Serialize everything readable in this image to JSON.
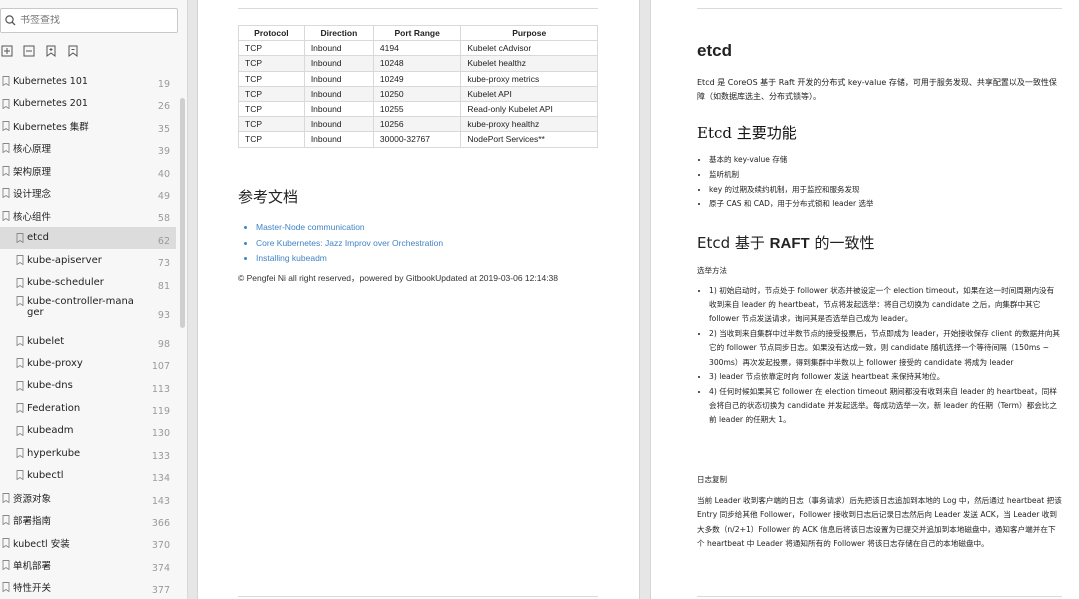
{
  "sidebar": {
    "search_placeholder": "书签查找",
    "items": [
      {
        "label": "Kubernetes 101",
        "page": "19",
        "level": 0
      },
      {
        "label": "Kubernetes 201",
        "page": "26",
        "level": 0
      },
      {
        "label": "Kubernetes 集群",
        "page": "35",
        "level": 0
      },
      {
        "label": "核心原理",
        "page": "39",
        "level": 0
      },
      {
        "label": "架构原理",
        "page": "40",
        "level": 0
      },
      {
        "label": "设计理念",
        "page": "49",
        "level": 0
      },
      {
        "label": "核心组件",
        "page": "58",
        "level": 0
      },
      {
        "label": "etcd",
        "page": "62",
        "level": 1,
        "active": true
      },
      {
        "label": "kube-apiserver",
        "page": "73",
        "level": 1
      },
      {
        "label": "kube-scheduler",
        "page": "81",
        "level": 1
      },
      {
        "label": "kube-controller-mana\nger",
        "page": "93",
        "level": 1
      },
      {
        "label": "kubelet",
        "page": "98",
        "level": 1
      },
      {
        "label": "kube-proxy",
        "page": "107",
        "level": 1
      },
      {
        "label": "kube-dns",
        "page": "113",
        "level": 1
      },
      {
        "label": "Federation",
        "page": "119",
        "level": 1
      },
      {
        "label": "kubeadm",
        "page": "130",
        "level": 1
      },
      {
        "label": "hyperkube",
        "page": "133",
        "level": 1
      },
      {
        "label": "kubectl",
        "page": "134",
        "level": 1
      },
      {
        "label": "资源对象",
        "page": "143",
        "level": 0
      },
      {
        "label": "部署指南",
        "page": "366",
        "level": 0
      },
      {
        "label": "kubectl 安装",
        "page": "370",
        "level": 0
      },
      {
        "label": "单机部署",
        "page": "374",
        "level": 0
      },
      {
        "label": "特性开关",
        "page": "377",
        "level": 0
      }
    ]
  },
  "left_page": {
    "table": {
      "headers": [
        "Protocol",
        "Direction",
        "Port Range",
        "Purpose"
      ],
      "rows": [
        [
          "TCP",
          "Inbound",
          "4194",
          "Kubelet cAdvisor"
        ],
        [
          "TCP",
          "Inbound",
          "10248",
          "Kubelet healthz"
        ],
        [
          "TCP",
          "Inbound",
          "10249",
          "kube-proxy metrics"
        ],
        [
          "TCP",
          "Inbound",
          "10250",
          "Kubelet API"
        ],
        [
          "TCP",
          "Inbound",
          "10255",
          "Read-only Kubelet API"
        ],
        [
          "TCP",
          "Inbound",
          "10256",
          "kube-proxy healthz"
        ],
        [
          "TCP",
          "Inbound",
          "30000-32767",
          "NodePort Services**"
        ]
      ]
    },
    "ref_title": "参考文档",
    "links": [
      "Master-Node communication",
      "Core Kubernetes: Jazz Improv over Orchestration",
      "Installing kubeadm"
    ],
    "copyright": "© Pengfei Ni all right reserved，powered by GitbookUpdated at 2019-03-06 12:14:38"
  },
  "right_page": {
    "title": "etcd",
    "intro": "Etcd 是 CoreOS 基于 Raft 开发的分布式 key-value 存储，可用于服务发现、共享配置以及一致性保障（如数据库选主、分布式锁等）。",
    "func_title": "Etcd 主要功能",
    "features": [
      "基本的 key-value 存储",
      "监听机制",
      "key 的过期及续约机制，用于监控和服务发现",
      "原子 CAS 和 CAD，用于分布式锁和 leader 选举"
    ],
    "raft_title_prefix": "Etcd 基于 ",
    "raft_title_bold": "RAFT",
    "raft_title_suffix": " 的一致性",
    "election_heading": "选举方法",
    "steps": [
      "1) 初始启动时，节点处于 follower 状态并被设定一个 election timeout，如果在这一时间周期内没有收到来自 leader 的 heartbeat，节点将发起选举：将自己切换为 candidate 之后，向集群中其它 follower 节点发送请求，询问其是否选举自己成为 leader。",
      "2) 当收到来自集群中过半数节点的接受投票后，节点即成为 leader，开始接收保存 client 的数据并向其它的 follower 节点同步日志。如果没有达成一致，则 candidate 随机选择一个等待间隔（150ms ~ 300ms）再次发起投票，得到集群中半数以上 follower 接受的 candidate 将成为 leader",
      "3) leader 节点依靠定时向 follower 发送 heartbeat 来保持其地位。",
      "4) 任何时候如果其它 follower 在 election timeout 期间都没有收到来自 leader 的 heartbeat，同样会将自己的状态切换为 candidate 并发起选举。每成功选举一次，新 leader 的任期（Term）都会比之前 leader 的任期大 1。"
    ],
    "log_heading": "日志复制",
    "log_para": "当前 Leader 收到客户端的日志（事务请求）后先把该日志追加到本地的 Log 中，然后通过 heartbeat 把该 Entry 同步给其他 Follower，Follower 接收到日志后记录日志然后向 Leader 发送 ACK，当 Leader 收到大多数（n/2+1）Follower 的 ACK 信息后将该日志设置为已提交并追加到本地磁盘中，通知客户端并在下个 heartbeat 中 Leader 将通知所有的 Follower 将该日志存储在自己的本地磁盘中。"
  }
}
